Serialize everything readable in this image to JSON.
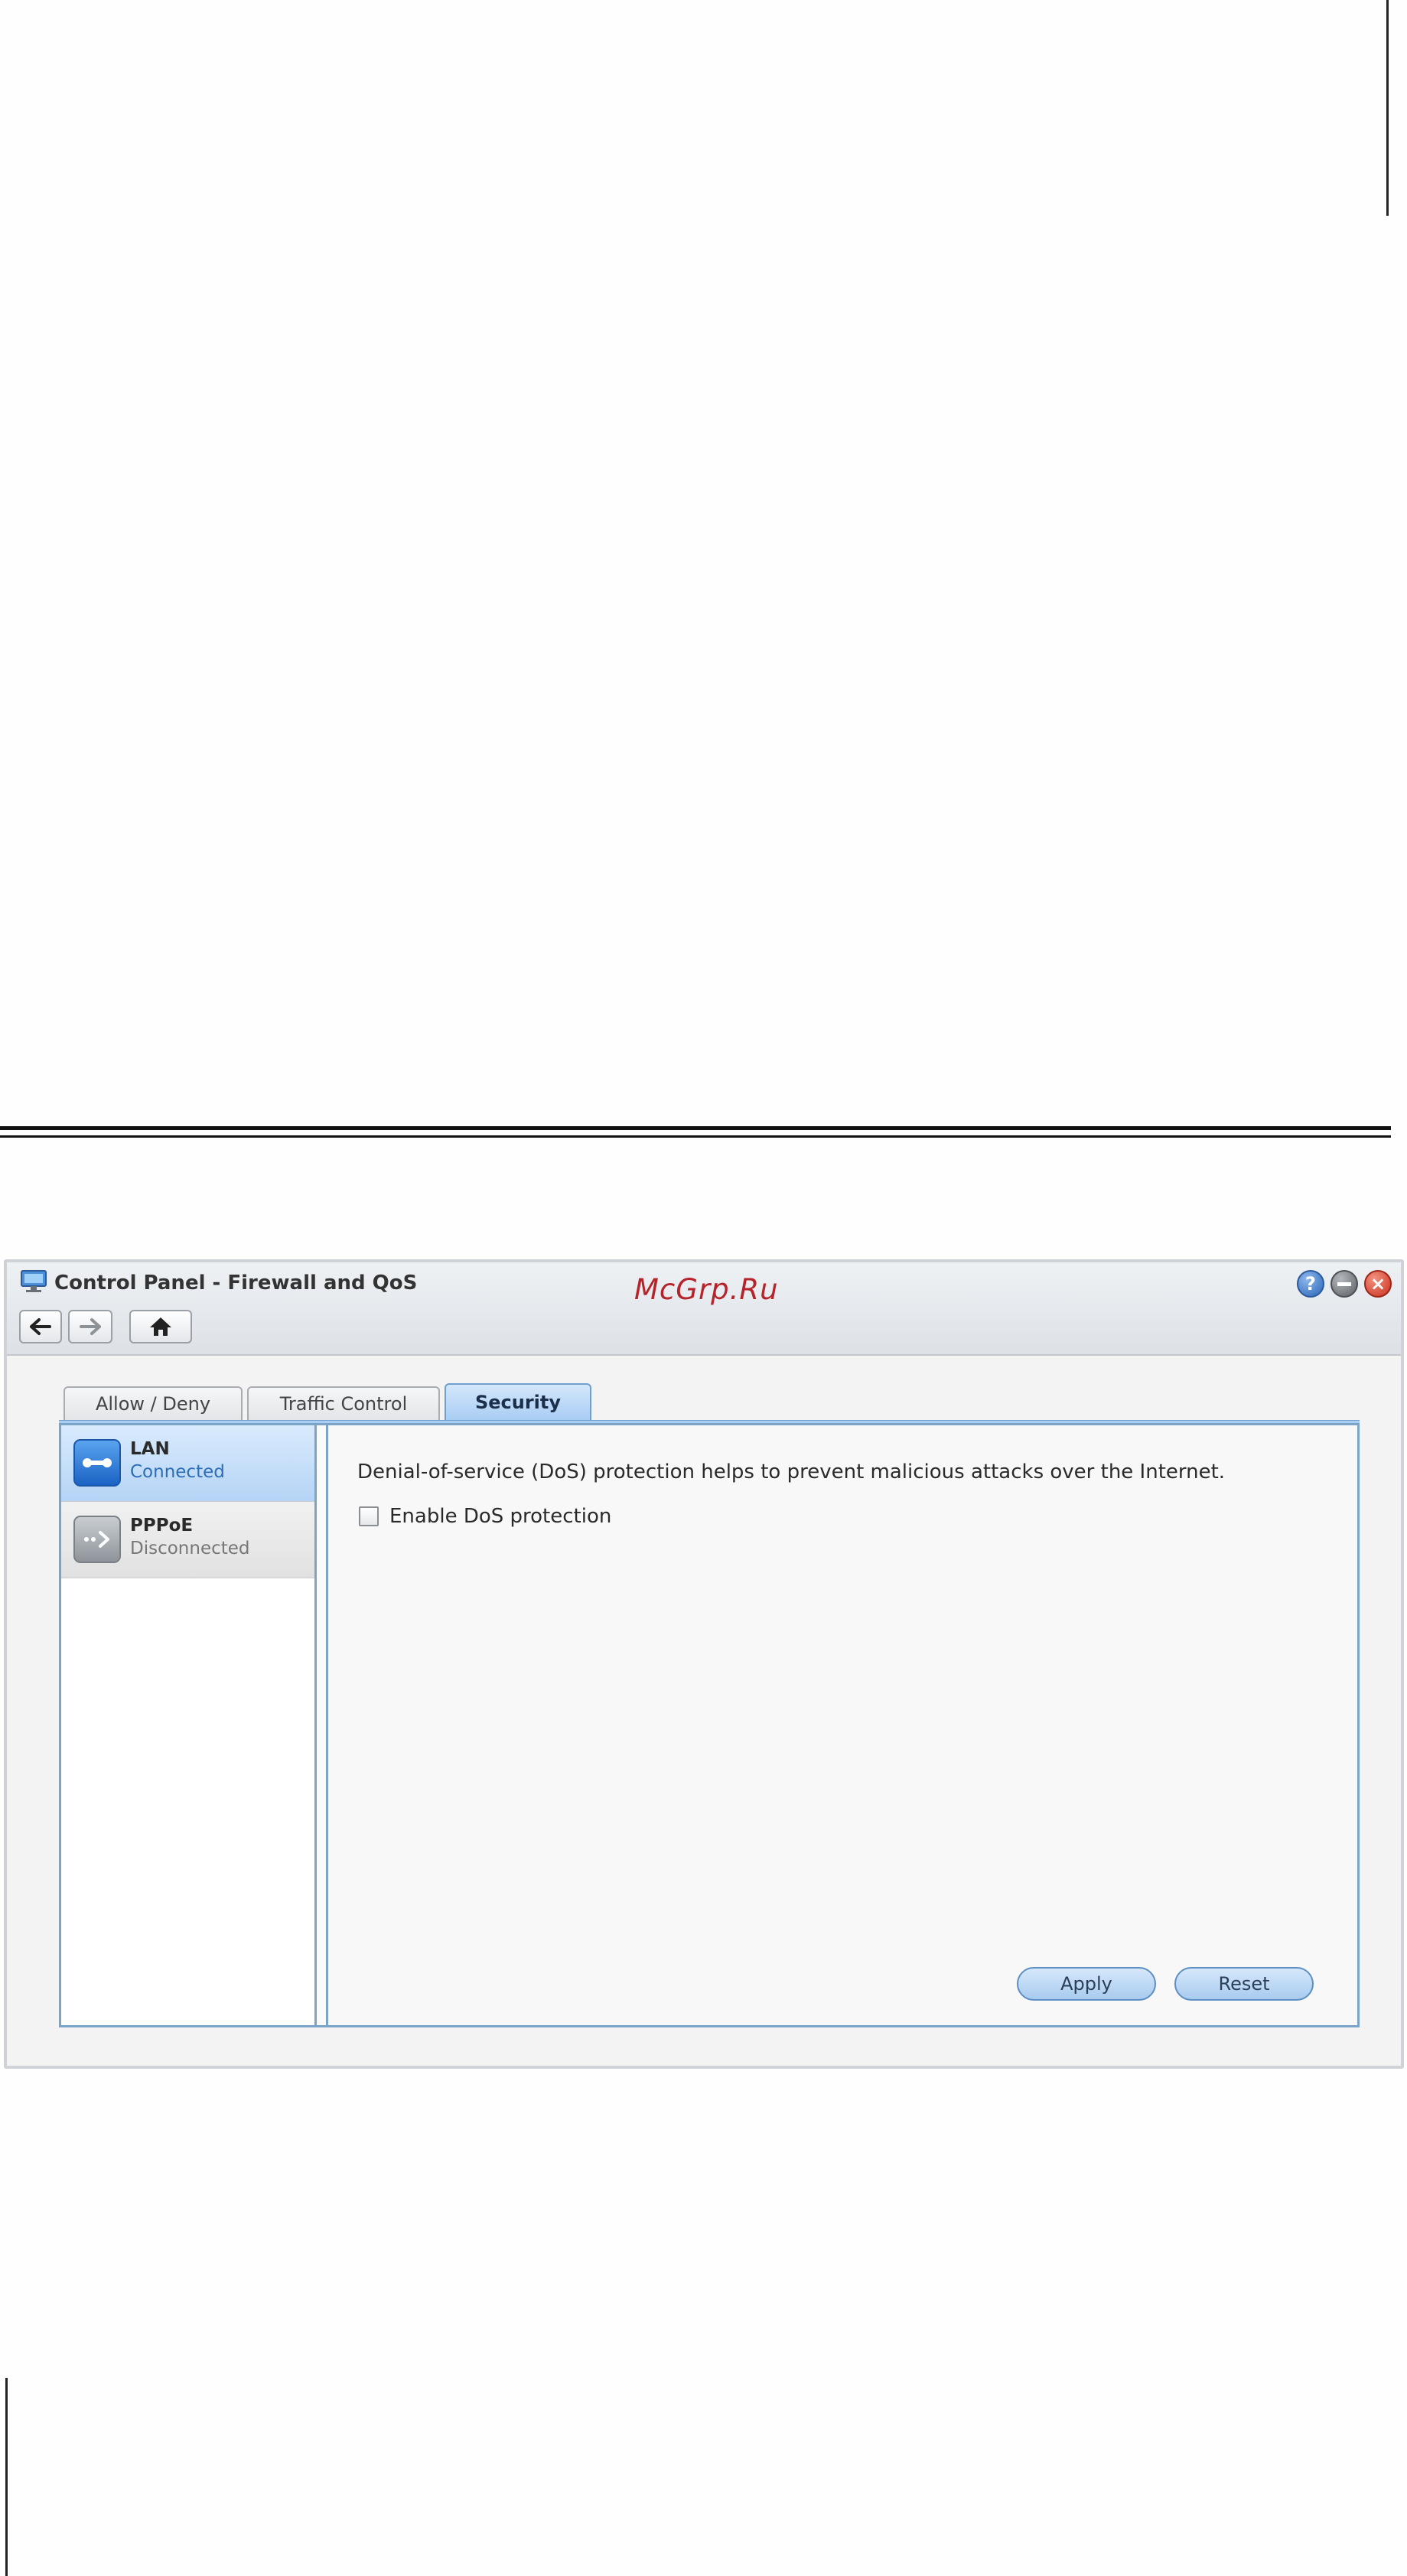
{
  "window": {
    "title": "Control Panel - Firewall and QoS",
    "watermark": "McGrp.Ru",
    "help_glyph": "?",
    "close_glyph": "×"
  },
  "icons": {
    "app": "control-panel-icon",
    "help": "help-icon",
    "minimize": "minimize-icon",
    "close": "close-icon",
    "back": "arrow-left-icon",
    "forward": "arrow-right-icon",
    "home": "home-icon",
    "lan": "lan-connection-icon",
    "pppoe": "pppoe-connection-icon"
  },
  "tabs": [
    {
      "label": "Allow / Deny",
      "active": false
    },
    {
      "label": "Traffic Control",
      "active": false
    },
    {
      "label": "Security",
      "active": true
    }
  ],
  "interfaces": [
    {
      "name": "LAN",
      "status": "Connected",
      "selected": true
    },
    {
      "name": "PPPoE",
      "status": "Disconnected",
      "selected": false
    }
  ],
  "security": {
    "description": "Denial-of-service (DoS) protection helps to prevent malicious attacks over the Internet.",
    "dos_checkbox_label": "Enable DoS protection",
    "dos_checked": false
  },
  "actions": {
    "apply_label": "Apply",
    "reset_label": "Reset"
  },
  "colors": {
    "accent": "#a9cdf3",
    "frame_border": "#7ba4c8",
    "watermark": "#b5242a",
    "close_button": "#c9301f"
  }
}
